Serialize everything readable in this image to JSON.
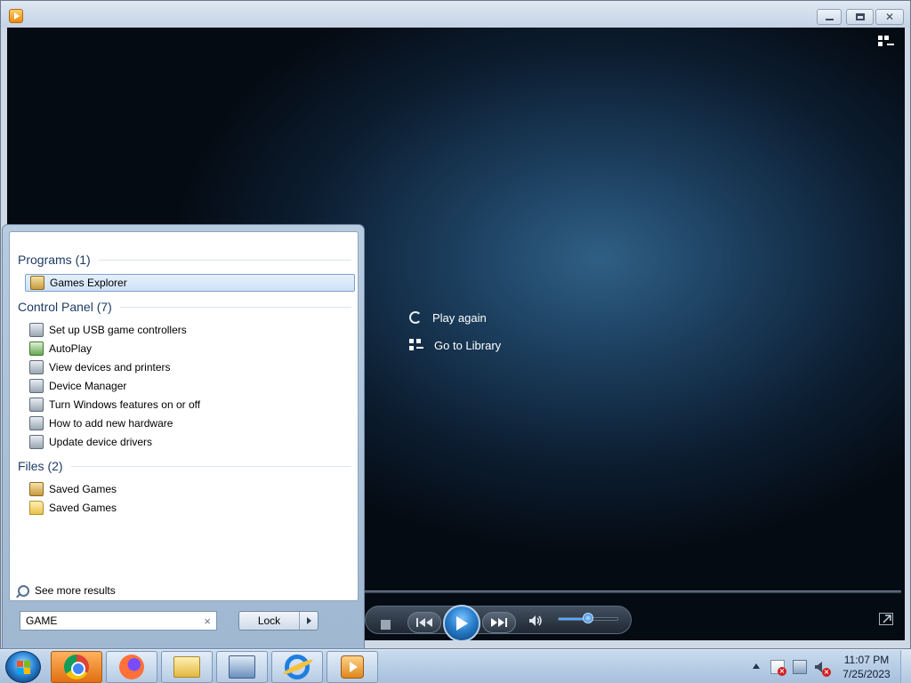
{
  "player": {
    "overlay": {
      "play_again": "Play again",
      "go_to_library": "Go to Library"
    },
    "volume_level": 0.5
  },
  "start_menu": {
    "groups": [
      {
        "header": "Programs (1)",
        "items": [
          "Games Explorer"
        ]
      },
      {
        "header": "Control Panel (7)",
        "items": [
          "Set up USB game controllers",
          "AutoPlay",
          "View devices and printers",
          "Device Manager",
          "Turn Windows features on or off",
          "How to add new hardware",
          "Update device drivers"
        ]
      },
      {
        "header": "Files (2)",
        "items": [
          "Saved Games",
          "Saved Games"
        ]
      }
    ],
    "see_more": "See more results",
    "search_value": "GAME",
    "clear_glyph": "×",
    "power_button": "Lock"
  },
  "taskbar": {
    "apps": [
      "Google Chrome",
      "Firefox",
      "Windows Explorer",
      "Control Panel",
      "Internet Explorer",
      "Windows Media Player"
    ],
    "clock": {
      "time": "11:07 PM",
      "date": "7/25/2023"
    }
  },
  "colors": {
    "selection_border": "#7da2ce",
    "header_text": "#1e3c64",
    "active_taskbar": "#e06f10"
  },
  "icons": {
    "window": "wmp-icon",
    "library": "switch-to-library-icon",
    "replay": "replay-icon",
    "library_link": "library-icon"
  }
}
